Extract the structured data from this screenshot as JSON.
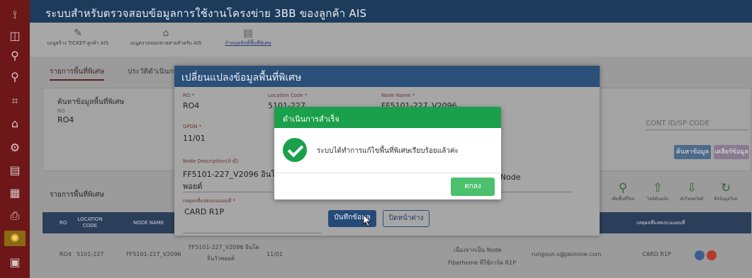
{
  "topbar": {
    "title": "ระบบสำหรับตรวจสอบข้อมูลการใช้งานโครงข่าย 3BB ของลูกค้า AIS"
  },
  "menu": [
    {
      "label": "เมนูสร้าง TICKET-ลูกค้า AIS",
      "icon": "ticket-icon"
    },
    {
      "label": "เมนูตรวจสอบข่ายสายสำหรับ AIS",
      "icon": "network-icon"
    },
    {
      "label": "กำหนดสิทธิ์พื้นที่พิเศษ",
      "icon": "printer-icon"
    }
  ],
  "tabs": [
    "รายการพื้นที่พิเศษ",
    "ประวัติดำเนินการพื้น"
  ],
  "search": {
    "title": "ค้นหาข้อมูลพื้นที่พิเศษ",
    "ro_label": "RO",
    "ro_value": "RO4",
    "cont_placeholder": "CONT ID/SP CODE",
    "search_button": "ค้นหาข้อมูล",
    "clear_button": "เคลียร์ข้อมูล"
  },
  "list": {
    "title": "รายการพื้นที่พิเศษ",
    "actions": [
      "เพิ่มพื้นที่ใหม่",
      "ไฟล์ต้นฉบับ",
      "อัปโหลดไฟล์",
      "ดึงข้อมูลใหม่"
    ]
  },
  "table": {
    "headers": [
      "RO",
      "LOCATION CODE",
      "NODE NAME",
      "เหตุผลที่แสดงบนแผนที่"
    ],
    "row": {
      "ro": "RO4",
      "location": "5101-227",
      "node": "FF5101-227_V2096",
      "desc_line1": "FF5101-227_V2096 อินโด",
      "desc_line2": "จีนวัวพอยต์",
      "gpon": "11/01",
      "reason_line1": "เนื่องจากเป็น Node",
      "reason_line2": "Fiberhome ที่ใช้การ์ด R1P",
      "email": "rungsun.s@jasmine.com",
      "card": "CARD R1P"
    }
  },
  "edit_modal": {
    "title": "เปลี่ยนแปลงข้อมูลพื้นที่พิเศษ",
    "ro_label": "RO *",
    "ro_value": "RO4",
    "location_label": "Location Code *",
    "location_value": "5101-227",
    "node_label": "Node Name *",
    "node_value": "FF5101-227_V2096",
    "gpon_label": "GPON *",
    "gpon_value": "11/01",
    "desc_label": "Node Description(ถ้ามี)",
    "desc_value_line1": "FF5101-227_V2096 อินโดจีน",
    "desc_value_line2": "พอยต์",
    "desc_right": "เป็น Node",
    "reason_label": "เหตุผลที่แสดงบนแผนที่ *",
    "reason_value": "CARD R1P",
    "save_button": "บันทึกข้อมูล",
    "close_button": "ปิดหน้าต่าง"
  },
  "dialog": {
    "title": "ดำเนินการสำเร็จ",
    "message": "ระบบได้ทำการแก้ไขพื้นที่พิเศษเรียบร้อยแล้วค่ะ",
    "ok_button": "ตกลง"
  },
  "colors": {
    "rail": "#6d1719",
    "topbar": "#1d3c5c",
    "success": "#1aa04a",
    "ok_button": "#4bc06d"
  }
}
